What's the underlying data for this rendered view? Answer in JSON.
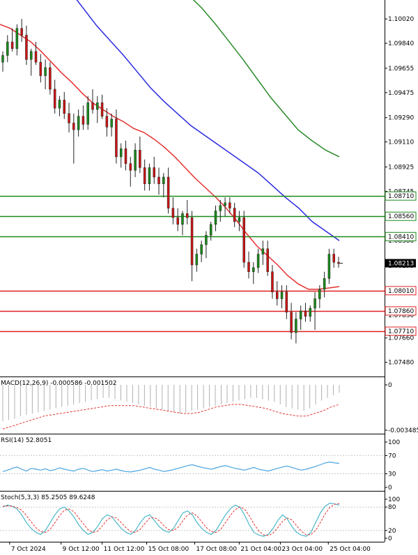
{
  "chart_data": [
    {
      "type": "candlestick",
      "price_axis_ticks": [
        "1.10020",
        "1.09840",
        "1.09655",
        "1.09475",
        "1.09290",
        "1.09110",
        "1.08925",
        "1.08745",
        "1.08560",
        "1.08380",
        "1.08195",
        "1.08010",
        "1.07830",
        "1.07660",
        "1.07480"
      ],
      "ylim": [
        1.0738,
        1.1016
      ],
      "current_price": "1.08213",
      "horizontal_levels": [
        {
          "label": "1.08710",
          "value": 1.0871,
          "color": "#1a8a1a"
        },
        {
          "label": "1.08560",
          "value": 1.0856,
          "color": "#1a8a1a"
        },
        {
          "label": "1.08410",
          "value": 1.0841,
          "color": "#1a8a1a"
        },
        {
          "label": "1.08010",
          "value": 1.0801,
          "color": "#e02020"
        },
        {
          "label": "1.07860",
          "value": 1.0786,
          "color": "#e02020"
        },
        {
          "label": "1.07710",
          "value": 1.0771,
          "color": "#e02020"
        }
      ],
      "colors": {
        "bull": "#1a8a1a",
        "bear": "#cc1414",
        "ma_fast": "#e53030",
        "ma_mid": "#2a2ae0",
        "ma_slow": "#2a8a2a"
      },
      "candles": [
        [
          1.097,
          1.0978,
          1.0963,
          1.0975
        ],
        [
          1.0975,
          1.099,
          1.097,
          1.0985
        ],
        [
          1.0985,
          1.0995,
          1.0978,
          1.098
        ],
        [
          1.098,
          1.0998,
          1.0975,
          1.0995
        ],
        [
          1.0995,
          1.1002,
          1.0985,
          1.099
        ],
        [
          1.099,
          1.0997,
          1.0968,
          1.0972
        ],
        [
          1.0972,
          1.098,
          1.096,
          1.0978
        ],
        [
          1.0978,
          1.0985,
          1.0968,
          1.097
        ],
        [
          1.097,
          1.0976,
          1.0955,
          1.096
        ],
        [
          1.096,
          1.0972,
          1.095,
          1.0966
        ],
        [
          1.0966,
          1.097,
          1.0946,
          1.095
        ],
        [
          1.095,
          1.0957,
          1.0932,
          1.0936
        ],
        [
          1.0936,
          1.0945,
          1.093,
          1.0942
        ],
        [
          1.0942,
          1.0948,
          1.0928,
          1.0932
        ],
        [
          1.0932,
          1.094,
          1.0918,
          1.0925
        ],
        [
          1.0925,
          1.0932,
          1.0895,
          1.092
        ],
        [
          1.092,
          1.0935,
          1.0915,
          1.093
        ],
        [
          1.093,
          1.0938,
          1.092,
          1.0924
        ],
        [
          1.0924,
          1.0945,
          1.092,
          1.094
        ],
        [
          1.094,
          1.095,
          1.0932,
          1.0935
        ],
        [
          1.0935,
          1.0945,
          1.0925,
          1.094
        ],
        [
          1.094,
          1.0946,
          1.0928,
          1.093
        ],
        [
          1.093,
          1.0936,
          1.0915,
          1.0922
        ],
        [
          1.0922,
          1.0932,
          1.0915,
          1.0928
        ],
        [
          1.0928,
          1.0935,
          1.0895,
          1.09
        ],
        [
          1.09,
          1.091,
          1.0892,
          1.0906
        ],
        [
          1.0906,
          1.0912,
          1.089,
          1.0895
        ],
        [
          1.0895,
          1.09,
          1.0878,
          1.089
        ],
        [
          1.089,
          1.091,
          1.0885,
          1.0905
        ],
        [
          1.0905,
          1.0915,
          1.0888,
          1.0892
        ],
        [
          1.0892,
          1.0898,
          1.0875,
          1.088
        ],
        [
          1.088,
          1.0895,
          1.0875,
          1.0892
        ],
        [
          1.0892,
          1.09,
          1.088,
          1.0885
        ],
        [
          1.0885,
          1.0892,
          1.0872,
          1.088
        ],
        [
          1.088,
          1.0888,
          1.087,
          1.0885
        ],
        [
          1.0885,
          1.0892,
          1.0858,
          1.0862
        ],
        [
          1.0862,
          1.087,
          1.085,
          1.0855
        ],
        [
          1.0855,
          1.0862,
          1.0845,
          1.085
        ],
        [
          1.085,
          1.086,
          1.0842,
          1.0858
        ],
        [
          1.0858,
          1.0868,
          1.085,
          1.0855
        ],
        [
          1.0855,
          1.086,
          1.0808,
          1.082
        ],
        [
          1.082,
          1.0832,
          1.0815,
          1.0828
        ],
        [
          1.0828,
          1.0838,
          1.0822,
          1.0835
        ],
        [
          1.0835,
          1.0845,
          1.0825,
          1.0842
        ],
        [
          1.0842,
          1.0852,
          1.0838,
          1.085
        ],
        [
          1.085,
          1.0864,
          1.0845,
          1.086
        ],
        [
          1.086,
          1.0868,
          1.0852,
          1.0864
        ],
        [
          1.0864,
          1.087,
          1.0856,
          1.0866
        ],
        [
          1.0866,
          1.087,
          1.0858,
          1.0862
        ],
        [
          1.0862,
          1.0866,
          1.0848,
          1.0852
        ],
        [
          1.0852,
          1.086,
          1.0845,
          1.0855
        ],
        [
          1.0855,
          1.086,
          1.0818,
          1.0822
        ],
        [
          1.0822,
          1.083,
          1.081,
          1.0815
        ],
        [
          1.0815,
          1.0822,
          1.0806,
          1.0818
        ],
        [
          1.0818,
          1.0832,
          1.0814,
          1.0828
        ],
        [
          1.0828,
          1.0838,
          1.082,
          1.0832
        ],
        [
          1.0832,
          1.0838,
          1.0812,
          1.0815
        ],
        [
          1.0815,
          1.082,
          1.0795,
          1.08
        ],
        [
          1.08,
          1.0808,
          1.079,
          1.0795
        ],
        [
          1.0795,
          1.0805,
          1.0788,
          1.08
        ],
        [
          1.08,
          1.0805,
          1.078,
          1.0785
        ],
        [
          1.0785,
          1.0792,
          1.0765,
          1.077
        ],
        [
          1.077,
          1.0785,
          1.0762,
          1.078
        ],
        [
          1.078,
          1.079,
          1.0772,
          1.0786
        ],
        [
          1.0786,
          1.0792,
          1.0778,
          1.0782
        ],
        [
          1.0782,
          1.079,
          1.0778,
          1.0788
        ],
        [
          1.0788,
          1.08,
          1.0772,
          1.0795
        ],
        [
          1.0795,
          1.0805,
          1.0788,
          1.0802
        ],
        [
          1.0802,
          1.0815,
          1.0796,
          1.081
        ],
        [
          1.081,
          1.0832,
          1.0806,
          1.0828
        ],
        [
          1.0828,
          1.0832,
          1.0818,
          1.0822
        ],
        [
          1.0822,
          1.0826,
          1.0818,
          1.0821
        ]
      ],
      "ma_fast": [
        1.0998,
        1.0995,
        1.099,
        1.0985,
        1.0978,
        1.097,
        1.0962,
        1.0955,
        1.0947,
        1.094,
        1.0935,
        1.093,
        1.0926,
        1.0921,
        1.0918,
        1.0913,
        1.0907,
        1.09,
        1.0892,
        1.0884,
        1.0877,
        1.087,
        1.0862,
        1.0853,
        1.0843,
        1.0834,
        1.0827,
        1.082,
        1.0812,
        1.0806,
        1.0802,
        1.0802,
        1.0803,
        1.0804
      ],
      "ma_mid_y": [
        1.1023,
        1.101,
        1.0997,
        1.0986,
        1.0975,
        1.0963,
        1.0951,
        1.0941,
        1.0932,
        1.0923,
        1.0916,
        1.0909,
        1.0902,
        1.0895,
        1.0888,
        1.0879,
        1.087,
        1.0862,
        1.0852,
        1.0845,
        1.0838
      ],
      "ma_slow_y": [
        1.102,
        1.101,
        1.0998,
        1.0985,
        1.0972,
        1.0958,
        1.0944,
        1.0932,
        1.092,
        1.0912,
        1.0905,
        1.09
      ]
    },
    {
      "type": "line",
      "title": "MACD(12,26,9) -0.000586 -0.001502",
      "y_ticks": [
        "0",
        "-0.003485"
      ],
      "ylim": [
        -0.003485,
        0
      ],
      "histogram": [
        -0.0028,
        -0.0027,
        -0.0026,
        -0.0024,
        -0.0023,
        -0.0022,
        -0.0021,
        -0.002,
        -0.0019,
        -0.0018,
        -0.0017,
        -0.0016,
        -0.0015,
        -0.0014,
        -0.0013,
        -0.0012,
        -0.0011,
        -0.001,
        -0.001,
        -0.0011,
        -0.0012,
        -0.0013,
        -0.0014,
        -0.0015,
        -0.0016,
        -0.0017,
        -0.0018,
        -0.0019,
        -0.002,
        -0.0021,
        -0.0022,
        -0.0021,
        -0.002,
        -0.0019,
        -0.0018,
        -0.0017,
        -0.0016,
        -0.0015,
        -0.0014,
        -0.0013,
        -0.0012,
        -0.0011,
        -0.001,
        -0.001,
        -0.0011,
        -0.0012,
        -0.0013,
        -0.0015,
        -0.0017,
        -0.0018,
        -0.0019,
        -0.002,
        -0.0018,
        -0.0015,
        -0.0012,
        -0.001,
        -0.0008,
        -0.0006
      ],
      "signal": [
        -0.0034,
        -0.0032,
        -0.003,
        -0.0028,
        -0.0026,
        -0.0024,
        -0.0023,
        -0.0022,
        -0.0021,
        -0.002,
        -0.0019,
        -0.0018,
        -0.0017,
        -0.0016,
        -0.0016,
        -0.0016,
        -0.0016,
        -0.0017,
        -0.0018,
        -0.0019,
        -0.002,
        -0.0021,
        -0.0022,
        -0.0022,
        -0.0021,
        -0.0019,
        -0.0017,
        -0.0016,
        -0.0015,
        -0.0015,
        -0.0016,
        -0.0017,
        -0.0018,
        -0.002,
        -0.0022,
        -0.0023,
        -0.0024,
        -0.0024,
        -0.0022,
        -0.002,
        -0.0017,
        -0.0015
      ]
    },
    {
      "type": "line",
      "title": "RSI(14) 52.8051",
      "y_ticks": [
        "100",
        "70",
        "30",
        "0"
      ],
      "ylim": [
        0,
        100
      ],
      "levels": [
        70,
        30
      ],
      "values": [
        35,
        38,
        42,
        45,
        40,
        36,
        42,
        40,
        38,
        41,
        37,
        39,
        43,
        40,
        38,
        36,
        40,
        42,
        38,
        35,
        37,
        39,
        36,
        38,
        40,
        37,
        35,
        34,
        36,
        38,
        41,
        44,
        40,
        38,
        35,
        37,
        39,
        42,
        45,
        48,
        50,
        47,
        44,
        42,
        40,
        43,
        46,
        48,
        45,
        42,
        40,
        38,
        41,
        44,
        40,
        38,
        36,
        39,
        42,
        45,
        47,
        44,
        41,
        38,
        40,
        43,
        46,
        50,
        54,
        56,
        54,
        53
      ]
    },
    {
      "type": "line",
      "title": "Stoch(5,3,3) 85.2505 89.6248",
      "y_ticks": [
        "100",
        "80",
        "20",
        "0"
      ],
      "ylim": [
        0,
        100
      ],
      "levels": [
        80,
        20
      ],
      "main": [
        80,
        85,
        82,
        75,
        60,
        40,
        25,
        15,
        10,
        20,
        40,
        60,
        75,
        80,
        70,
        55,
        35,
        20,
        10,
        15,
        30,
        50,
        60,
        55,
        40,
        25,
        15,
        10,
        20,
        40,
        55,
        60,
        45,
        30,
        20,
        15,
        25,
        45,
        65,
        70,
        60,
        40,
        25,
        15,
        10,
        20,
        40,
        60,
        75,
        85,
        80,
        60,
        35,
        15,
        8,
        5,
        10,
        25,
        45,
        60,
        50,
        30,
        15,
        8,
        5,
        15,
        40,
        65,
        82,
        90,
        88,
        85
      ],
      "signal": [
        82,
        83,
        82,
        79,
        72,
        58,
        42,
        27,
        17,
        15,
        23,
        40,
        58,
        72,
        75,
        68,
        53,
        37,
        22,
        15,
        18,
        32,
        47,
        55,
        52,
        40,
        27,
        17,
        15,
        23,
        38,
        52,
        53,
        45,
        32,
        22,
        20,
        28,
        45,
        60,
        65,
        57,
        42,
        27,
        17,
        15,
        23,
        40,
        58,
        73,
        80,
        75,
        58,
        37,
        19,
        9,
        7,
        13,
        27,
        43,
        52,
        47,
        32,
        18,
        9,
        9,
        20,
        40,
        62,
        79,
        87,
        89
      ]
    }
  ],
  "time_axis_labels": [
    "7 Oct 2024",
    "9 Oct 12:00",
    "11 Oct 12:00",
    "15 Oct 08:00",
    "17 Oct 08:00",
    "21 Oct 04:00",
    "23 Oct 04:00",
    "25 Oct 04:00"
  ],
  "time_axis_values": [
    2,
    17,
    29,
    42,
    56,
    69,
    81,
    95
  ]
}
